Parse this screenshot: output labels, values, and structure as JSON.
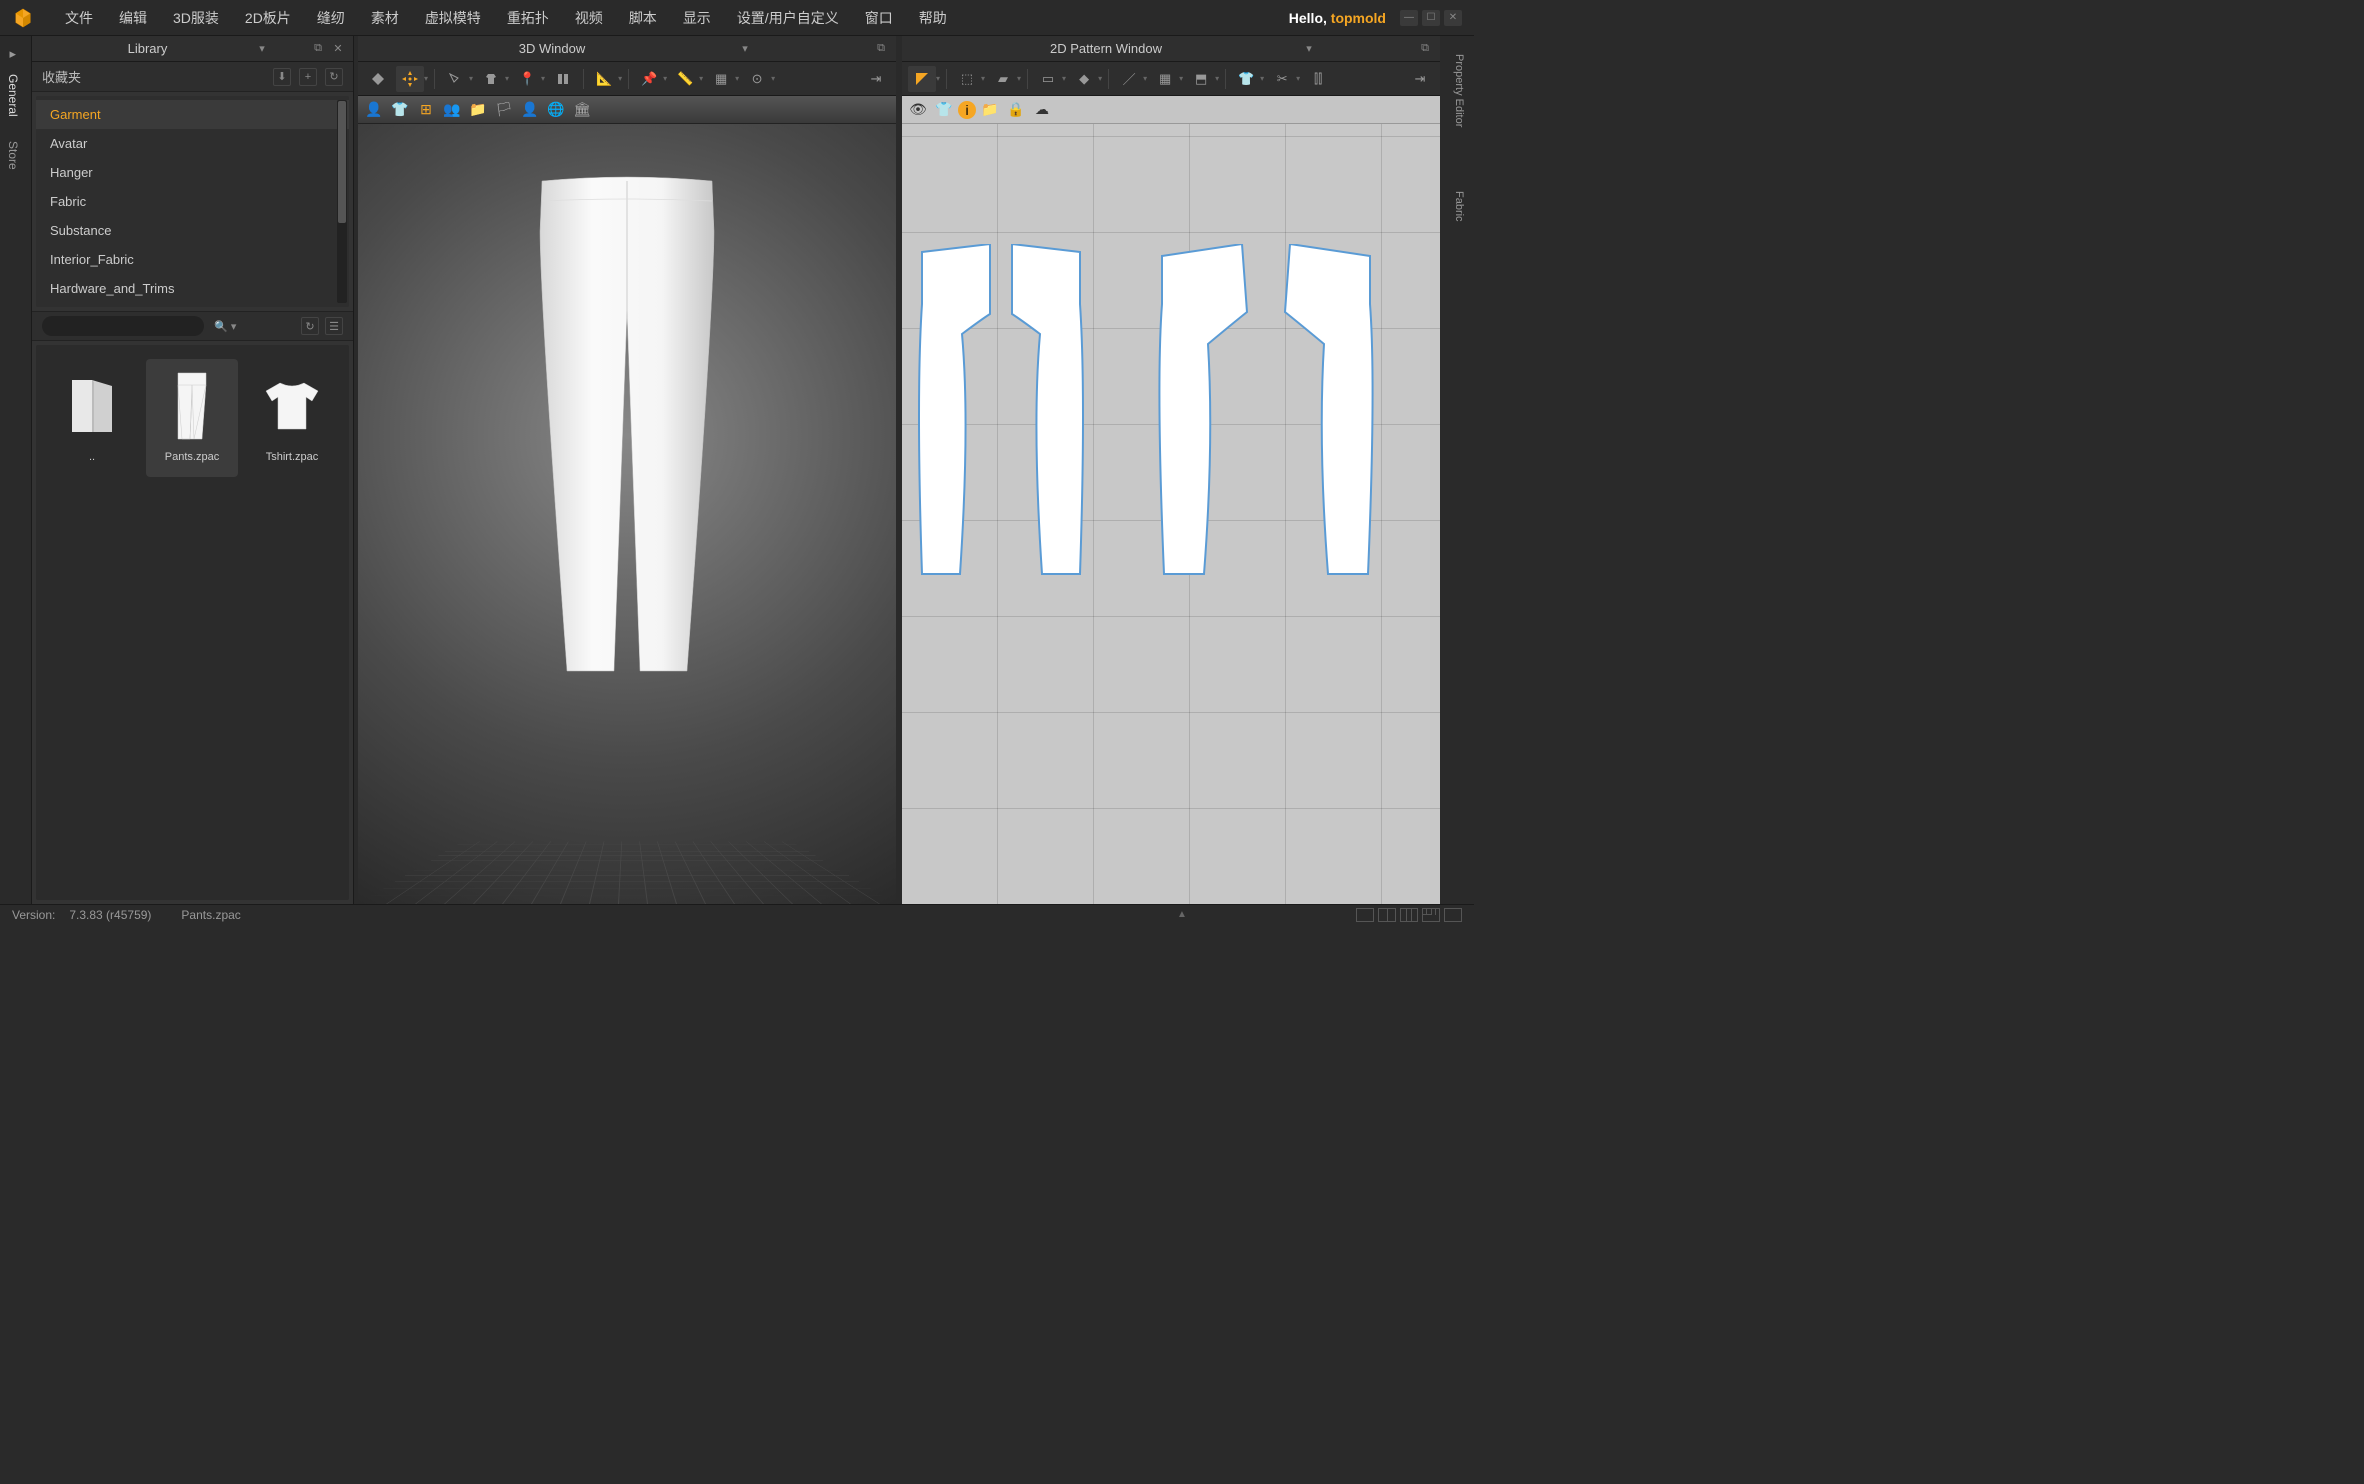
{
  "menubar": {
    "items": [
      "文件",
      "编辑",
      "3D服装",
      "2D板片",
      "缝纫",
      "素材",
      "虚拟模特",
      "重拓扑",
      "视频",
      "脚本",
      "显示",
      "设置/用户自定义",
      "窗口",
      "帮助"
    ],
    "hello_prefix": "Hello, ",
    "username": "topmold"
  },
  "left_tabs": [
    "General",
    "Store"
  ],
  "library": {
    "title": "Library",
    "fav_title": "收藏夹",
    "categories": [
      "Garment",
      "Avatar",
      "Hanger",
      "Fabric",
      "Substance",
      "Interior_Fabric",
      "Hardware_and_Trims"
    ],
    "active_category": 0,
    "files": [
      {
        "name": "..",
        "type": "folder"
      },
      {
        "name": "Pants.zpac",
        "type": "pants",
        "selected": true
      },
      {
        "name": "Tshirt.zpac",
        "type": "tshirt"
      }
    ]
  },
  "viewport3d": {
    "title": "3D Window"
  },
  "viewport2d": {
    "title": "2D Pattern Window"
  },
  "right_tabs": [
    "Property Editor",
    "Fabric"
  ],
  "status": {
    "version_label": "Version:",
    "version": "7.3.83 (r45759)",
    "file": "Pants.zpac"
  }
}
